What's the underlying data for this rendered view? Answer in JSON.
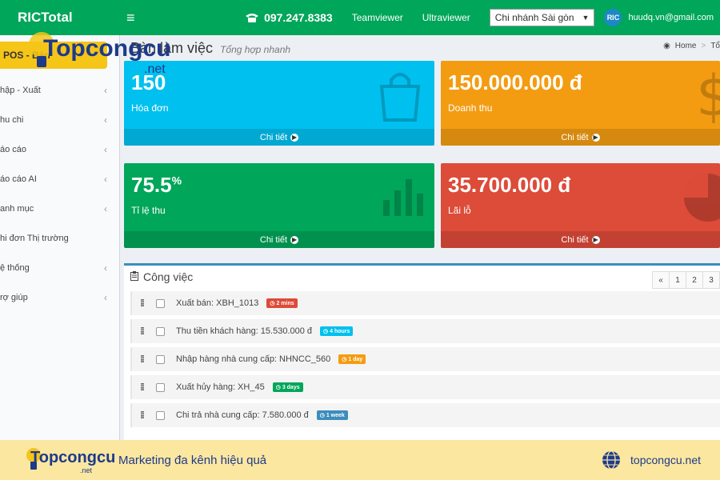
{
  "header": {
    "logo": "RICTotal",
    "phone": "097.247.8383",
    "links": [
      "Teamviewer",
      "Ultraviewer"
    ],
    "branch": "Chi nhánh Sài gòn",
    "user_badge": "RIC",
    "user_email": "huudq.vn@gmail.com"
  },
  "sidebar": {
    "pos_label": "POS - Bán",
    "items": [
      {
        "label": "hập - Xuất",
        "chevron": "‹"
      },
      {
        "label": "hu chi",
        "chevron": "‹"
      },
      {
        "label": "áo cáo",
        "chevron": "‹"
      },
      {
        "label": "áo cáo AI",
        "chevron": "‹"
      },
      {
        "label": "anh mục",
        "chevron": "‹"
      },
      {
        "label": "hi đơn Thị trường",
        "chevron": ""
      },
      {
        "label": "ệ thống",
        "chevron": "‹"
      },
      {
        "label": "rợ giúp",
        "chevron": "‹"
      }
    ]
  },
  "page": {
    "title": "Bàn làm việc",
    "subtitle": "Tổng hợp nhanh",
    "breadcrumb": [
      "Home",
      "Tổ"
    ]
  },
  "boxes": [
    {
      "value": "150",
      "suffix": "",
      "label": "Hóa đơn",
      "footer": "Chi tiết",
      "color": "#00c0ef"
    },
    {
      "value": "150.000.000 đ",
      "suffix": "",
      "label": "Doanh thu",
      "footer": "Chi tiết",
      "color": "#f39c12"
    },
    {
      "value": "75.5",
      "suffix": "%",
      "label": "Tỉ lệ thu",
      "footer": "Chi tiết",
      "color": "#00a65a"
    },
    {
      "value": "35.700.000 đ",
      "suffix": "",
      "label": "Lãi lỗ",
      "footer": "Chi tiết",
      "color": "#dd4b39"
    }
  ],
  "tasks": {
    "title": "Công việc",
    "pager": [
      "«",
      "1",
      "2",
      "3"
    ],
    "items": [
      {
        "text": "Xuất bán: XBH_1013",
        "badge": "2 mins",
        "badge_color": "#dd4b39"
      },
      {
        "text": "Thu tiền khách hàng: 15.530.000 đ",
        "badge": "4 hours",
        "badge_color": "#00c0ef"
      },
      {
        "text": "Nhập hàng nhà cung cấp: NHNCC_560",
        "badge": "1 day",
        "badge_color": "#f39c12"
      },
      {
        "text": "Xuất hủy hàng: XH_45",
        "badge": "3 days",
        "badge_color": "#00a65a"
      },
      {
        "text": "Chi trả nhà cung cấp: 7.580.000 đ",
        "badge": "1 week",
        "badge_color": "#3c8dbc"
      }
    ]
  },
  "watermark": {
    "brand": "Topcongcu",
    "suffix": ".net"
  },
  "banner": {
    "brand": "Topcongcu",
    "brand_suffix": ".net",
    "tagline": "Marketing đa kênh hiệu quả",
    "site": "topcongcu.net"
  }
}
